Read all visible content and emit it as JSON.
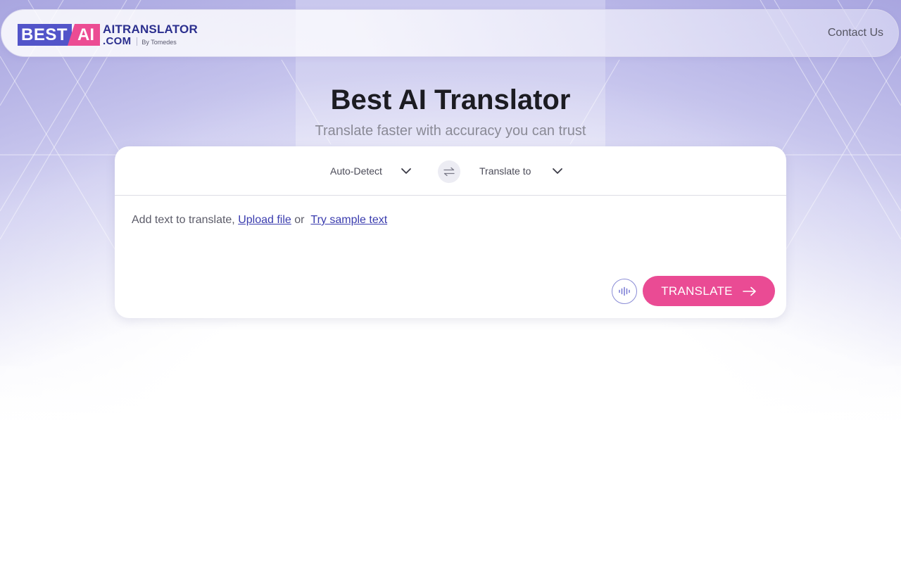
{
  "header": {
    "logo": {
      "best": "BEST",
      "ai": "AI",
      "line1": "AITRANSLATOR",
      "line2": ".COM",
      "by": "By Tomedes"
    },
    "contact_label": "Contact Us"
  },
  "hero": {
    "title": "Best AI Translator",
    "subtitle": "Translate faster with accuracy you can trust"
  },
  "translator": {
    "source_language": "Auto-Detect",
    "target_language": "Translate to",
    "input_prompt": "Add text to translate, ",
    "upload_link": "Upload file",
    "or_text": " or ",
    "sample_link": "Try sample text",
    "translate_label": "TRANSLATE"
  },
  "colors": {
    "brand_blue": "#5254c9",
    "brand_pink": "#ec4c93",
    "link": "#3a3cae"
  },
  "icons": [
    "chevron-down-icon",
    "swap-icon",
    "microphone-icon",
    "arrow-right-icon"
  ]
}
